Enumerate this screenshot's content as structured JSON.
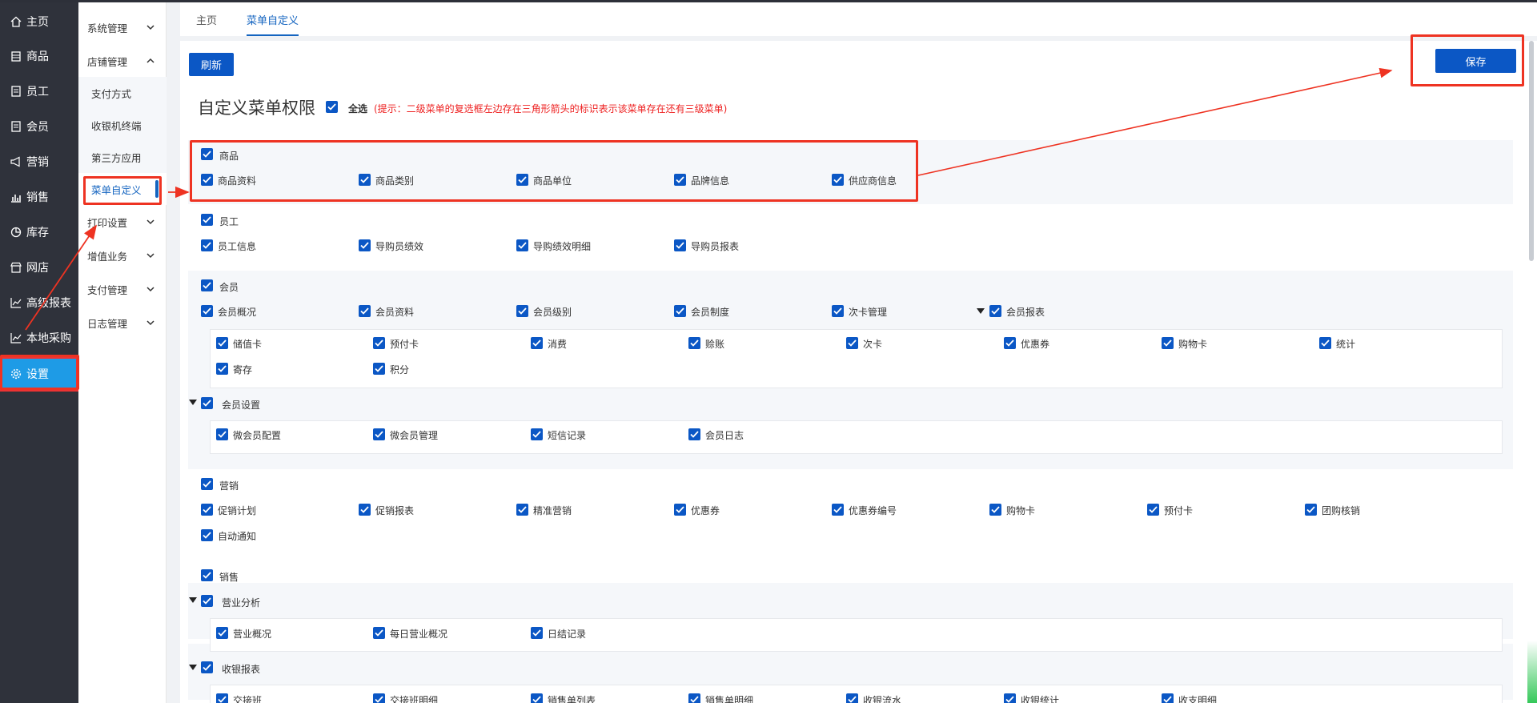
{
  "main_nav": [
    {
      "label": "主页",
      "icon": "home-icon"
    },
    {
      "label": "商品",
      "icon": "store-icon"
    },
    {
      "label": "员工",
      "icon": "document-icon"
    },
    {
      "label": "会员",
      "icon": "document-icon"
    },
    {
      "label": "营销",
      "icon": "megaphone-icon"
    },
    {
      "label": "销售",
      "icon": "bar-chart-icon"
    },
    {
      "label": "库存",
      "icon": "pie-chart-icon"
    },
    {
      "label": "网店",
      "icon": "store-icon"
    },
    {
      "label": "高级报表",
      "icon": "line-chart-icon"
    },
    {
      "label": "本地采购",
      "icon": "line-chart-icon"
    },
    {
      "label": "设置",
      "icon": "gear-icon",
      "active": true
    }
  ],
  "sub_nav": {
    "sections": [
      "系统管理",
      "店铺管理"
    ],
    "children": [
      "支付方式",
      "收银机终端",
      "第三方应用",
      "菜单自定义"
    ],
    "more": [
      "打印设置",
      "增值业务",
      "支付管理",
      "日志管理"
    ],
    "active_child": "菜单自定义"
  },
  "tabs": [
    "主页",
    "菜单自定义"
  ],
  "active_tab": "菜单自定义",
  "toolbar": {
    "refresh": "刷新",
    "save": "保存"
  },
  "page_title": "自定义菜单权限",
  "select_all": "全选",
  "hint": "(提示：二级菜单的复选框左边存在三角形箭头的标识表示该菜单存在还有三级菜单)",
  "groups": [
    {
      "name": "商品",
      "items": [
        "商品资料",
        "商品类别",
        "商品单位",
        "品牌信息",
        "供应商信息"
      ]
    },
    {
      "name": "员工",
      "items": [
        "员工信息",
        "导购员绩效",
        "导购绩效明细",
        "导购员报表"
      ]
    },
    {
      "name": "会员",
      "items": [
        "会员概况",
        "会员资料",
        "会员级别",
        "会员制度",
        "次卡管理",
        "会员报表"
      ],
      "member_report_items": [
        "储值卡",
        "预付卡",
        "消费",
        "赊账",
        "次卡",
        "优惠券",
        "购物卡",
        "统计",
        "寄存",
        "积分"
      ],
      "settings": "会员设置",
      "settings_items": [
        "微会员配置",
        "微会员管理",
        "短信记录",
        "会员日志"
      ]
    },
    {
      "name": "营销",
      "items": [
        "促销计划",
        "促销报表",
        "精准营销",
        "优惠券",
        "优惠券编号",
        "购物卡",
        "预付卡",
        "团购核销",
        "自动通知"
      ]
    },
    {
      "name": "销售",
      "business": "营业分析",
      "business_items": [
        "营业概况",
        "每日营业概况",
        "日结记录"
      ],
      "cashier": "收银报表",
      "cashier_items": [
        "交接班",
        "交接班明细",
        "销售单列表",
        "销售单明细",
        "收银流水",
        "收银统计",
        "收支明细"
      ]
    }
  ],
  "colors": {
    "primary": "#0b57c5",
    "sidebar": "#2f323b",
    "active": "#1e9be6",
    "annotation": "#e33"
  }
}
